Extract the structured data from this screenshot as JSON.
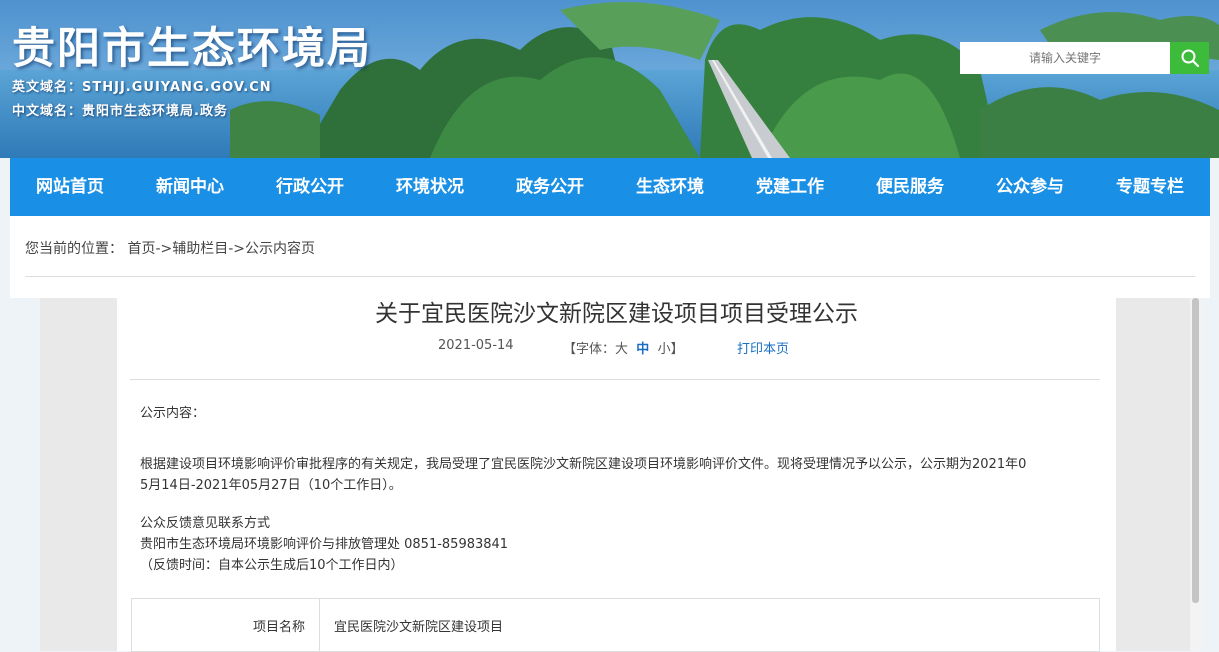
{
  "header": {
    "site_title": "贵阳市生态环境局",
    "en_domain": "英文域名：STHJJ.GUIYANG.GOV.CN",
    "cn_domain": "中文域名：贵阳市生态环境局.政务",
    "search_placeholder": "请输入关键字"
  },
  "nav": {
    "items": [
      "网站首页",
      "新闻中心",
      "行政公开",
      "环境状况",
      "政务公开",
      "生态环境",
      "党建工作",
      "便民服务",
      "公众参与",
      "专题专栏"
    ]
  },
  "breadcrumb": {
    "prefix": "您当前的位置：",
    "home": "首页",
    "sep1": "->",
    "section": "辅助栏目",
    "sep2": "->",
    "current": "公示内容页"
  },
  "article": {
    "title": "关于宜民医院沙文新院区建设项目项目受理公示",
    "date": "2021-05-14",
    "font_open": "【字体：",
    "font_large": "大",
    "font_medium": "中",
    "font_small": "小",
    "font_close": "】",
    "print_label": "打印本页",
    "intro_label": "公示内容：",
    "paragraph_line1": "根据建设项目环境影响评价审批程序的有关规定，我局受理了宜民医院沙文新院区建设项目环境影响评价文件。现将受理情况予以公示，公示期为2021年0",
    "paragraph_line2": "5月14日-2021年05月27日（10个工作日）。",
    "contact_title": "公众反馈意见联系方式",
    "contact_line": "贵阳市生态环境局环境影响评价与排放管理处 0851-85983841",
    "feedback_time": "（反馈时间：自本公示生成后10个工作日内）",
    "table": [
      {
        "label": "项目名称",
        "value": "宜民医院沙文新院区建设项目"
      }
    ]
  }
}
